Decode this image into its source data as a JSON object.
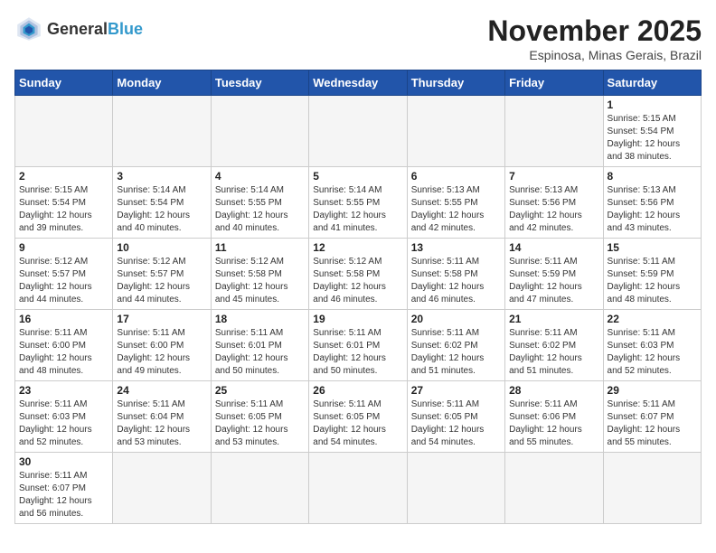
{
  "header": {
    "logo_general": "General",
    "logo_blue": "Blue",
    "month_year": "November 2025",
    "location": "Espinosa, Minas Gerais, Brazil"
  },
  "weekdays": [
    "Sunday",
    "Monday",
    "Tuesday",
    "Wednesday",
    "Thursday",
    "Friday",
    "Saturday"
  ],
  "weeks": [
    [
      {
        "day": "",
        "info": ""
      },
      {
        "day": "",
        "info": ""
      },
      {
        "day": "",
        "info": ""
      },
      {
        "day": "",
        "info": ""
      },
      {
        "day": "",
        "info": ""
      },
      {
        "day": "",
        "info": ""
      },
      {
        "day": "1",
        "info": "Sunrise: 5:15 AM\nSunset: 5:54 PM\nDaylight: 12 hours\nand 38 minutes."
      }
    ],
    [
      {
        "day": "2",
        "info": "Sunrise: 5:15 AM\nSunset: 5:54 PM\nDaylight: 12 hours\nand 39 minutes."
      },
      {
        "day": "3",
        "info": "Sunrise: 5:14 AM\nSunset: 5:54 PM\nDaylight: 12 hours\nand 40 minutes."
      },
      {
        "day": "4",
        "info": "Sunrise: 5:14 AM\nSunset: 5:55 PM\nDaylight: 12 hours\nand 40 minutes."
      },
      {
        "day": "5",
        "info": "Sunrise: 5:14 AM\nSunset: 5:55 PM\nDaylight: 12 hours\nand 41 minutes."
      },
      {
        "day": "6",
        "info": "Sunrise: 5:13 AM\nSunset: 5:55 PM\nDaylight: 12 hours\nand 42 minutes."
      },
      {
        "day": "7",
        "info": "Sunrise: 5:13 AM\nSunset: 5:56 PM\nDaylight: 12 hours\nand 42 minutes."
      },
      {
        "day": "8",
        "info": "Sunrise: 5:13 AM\nSunset: 5:56 PM\nDaylight: 12 hours\nand 43 minutes."
      }
    ],
    [
      {
        "day": "9",
        "info": "Sunrise: 5:12 AM\nSunset: 5:57 PM\nDaylight: 12 hours\nand 44 minutes."
      },
      {
        "day": "10",
        "info": "Sunrise: 5:12 AM\nSunset: 5:57 PM\nDaylight: 12 hours\nand 44 minutes."
      },
      {
        "day": "11",
        "info": "Sunrise: 5:12 AM\nSunset: 5:58 PM\nDaylight: 12 hours\nand 45 minutes."
      },
      {
        "day": "12",
        "info": "Sunrise: 5:12 AM\nSunset: 5:58 PM\nDaylight: 12 hours\nand 46 minutes."
      },
      {
        "day": "13",
        "info": "Sunrise: 5:11 AM\nSunset: 5:58 PM\nDaylight: 12 hours\nand 46 minutes."
      },
      {
        "day": "14",
        "info": "Sunrise: 5:11 AM\nSunset: 5:59 PM\nDaylight: 12 hours\nand 47 minutes."
      },
      {
        "day": "15",
        "info": "Sunrise: 5:11 AM\nSunset: 5:59 PM\nDaylight: 12 hours\nand 48 minutes."
      }
    ],
    [
      {
        "day": "16",
        "info": "Sunrise: 5:11 AM\nSunset: 6:00 PM\nDaylight: 12 hours\nand 48 minutes."
      },
      {
        "day": "17",
        "info": "Sunrise: 5:11 AM\nSunset: 6:00 PM\nDaylight: 12 hours\nand 49 minutes."
      },
      {
        "day": "18",
        "info": "Sunrise: 5:11 AM\nSunset: 6:01 PM\nDaylight: 12 hours\nand 50 minutes."
      },
      {
        "day": "19",
        "info": "Sunrise: 5:11 AM\nSunset: 6:01 PM\nDaylight: 12 hours\nand 50 minutes."
      },
      {
        "day": "20",
        "info": "Sunrise: 5:11 AM\nSunset: 6:02 PM\nDaylight: 12 hours\nand 51 minutes."
      },
      {
        "day": "21",
        "info": "Sunrise: 5:11 AM\nSunset: 6:02 PM\nDaylight: 12 hours\nand 51 minutes."
      },
      {
        "day": "22",
        "info": "Sunrise: 5:11 AM\nSunset: 6:03 PM\nDaylight: 12 hours\nand 52 minutes."
      }
    ],
    [
      {
        "day": "23",
        "info": "Sunrise: 5:11 AM\nSunset: 6:03 PM\nDaylight: 12 hours\nand 52 minutes."
      },
      {
        "day": "24",
        "info": "Sunrise: 5:11 AM\nSunset: 6:04 PM\nDaylight: 12 hours\nand 53 minutes."
      },
      {
        "day": "25",
        "info": "Sunrise: 5:11 AM\nSunset: 6:05 PM\nDaylight: 12 hours\nand 53 minutes."
      },
      {
        "day": "26",
        "info": "Sunrise: 5:11 AM\nSunset: 6:05 PM\nDaylight: 12 hours\nand 54 minutes."
      },
      {
        "day": "27",
        "info": "Sunrise: 5:11 AM\nSunset: 6:05 PM\nDaylight: 12 hours\nand 54 minutes."
      },
      {
        "day": "28",
        "info": "Sunrise: 5:11 AM\nSunset: 6:06 PM\nDaylight: 12 hours\nand 55 minutes."
      },
      {
        "day": "29",
        "info": "Sunrise: 5:11 AM\nSunset: 6:07 PM\nDaylight: 12 hours\nand 55 minutes."
      }
    ],
    [
      {
        "day": "30",
        "info": "Sunrise: 5:11 AM\nSunset: 6:07 PM\nDaylight: 12 hours\nand 56 minutes."
      },
      {
        "day": "",
        "info": ""
      },
      {
        "day": "",
        "info": ""
      },
      {
        "day": "",
        "info": ""
      },
      {
        "day": "",
        "info": ""
      },
      {
        "day": "",
        "info": ""
      },
      {
        "day": "",
        "info": ""
      }
    ]
  ]
}
